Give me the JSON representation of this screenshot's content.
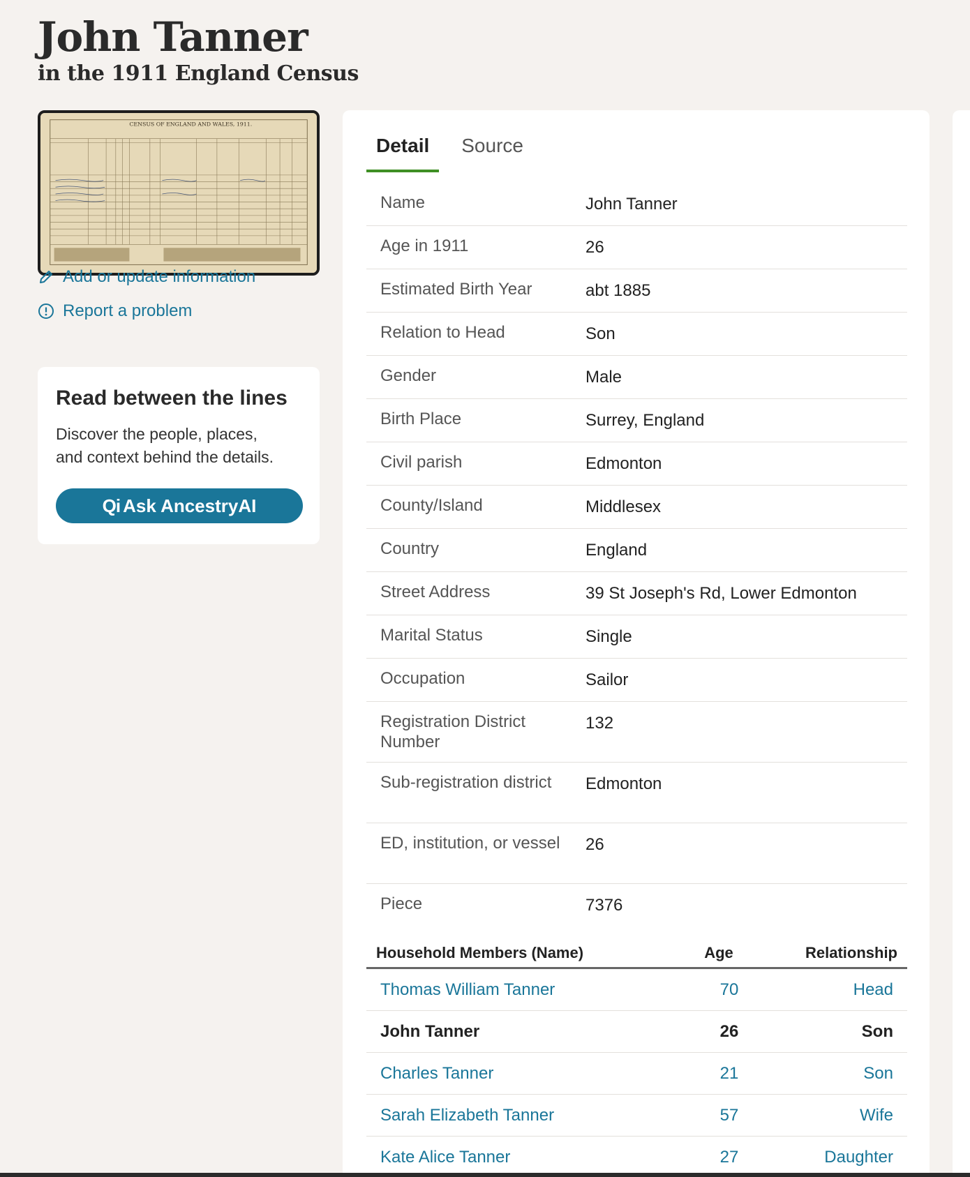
{
  "header": {
    "title": "John Tanner",
    "subtitle": "in the 1911 England Census"
  },
  "thumbnail": {
    "heading": "CENSUS OF ENGLAND AND WALES, 1911."
  },
  "sidebar": {
    "add_update_label": "Add or update information",
    "report_label": "Report a problem",
    "promo": {
      "title": "Read between the lines",
      "text_line1": "Discover the people, places,",
      "text_line2": "and context behind the details.",
      "button_mark": "Qi",
      "button_label": "Ask AncestryAI"
    }
  },
  "tabs": [
    {
      "label": "Detail",
      "active": true
    },
    {
      "label": "Source",
      "active": false
    }
  ],
  "details": [
    {
      "label": "Name",
      "value": "John Tanner"
    },
    {
      "label": "Age in 1911",
      "value": "26"
    },
    {
      "label": "Estimated Birth Year",
      "value": "abt 1885"
    },
    {
      "label": "Relation to Head",
      "value": "Son"
    },
    {
      "label": "Gender",
      "value": "Male"
    },
    {
      "label": "Birth Place",
      "value": "Surrey, England"
    },
    {
      "label": "Civil parish",
      "value": "Edmonton"
    },
    {
      "label": "County/Island",
      "value": "Middlesex"
    },
    {
      "label": "Country",
      "value": "England"
    },
    {
      "label": "Street Address",
      "value": "39 St Joseph's Rd, Lower Edmonton"
    },
    {
      "label": "Marital Status",
      "value": "Single"
    },
    {
      "label": "Occupation",
      "value": "Sailor"
    },
    {
      "label": "Registration District Number",
      "value": "132"
    },
    {
      "label": "Sub-registration district",
      "value": "Edmonton"
    },
    {
      "label": "ED, institution, or vessel",
      "value": "26"
    },
    {
      "label": "Piece",
      "value": "7376"
    }
  ],
  "household": {
    "headers": {
      "name": "Household Members (Name)",
      "age": "Age",
      "relationship": "Relationship"
    },
    "rows": [
      {
        "name": "Thomas William Tanner",
        "age": "70",
        "relationship": "Head"
      },
      {
        "name": "John Tanner",
        "age": "26",
        "relationship": "Son"
      },
      {
        "name": "Charles Tanner",
        "age": "21",
        "relationship": "Son"
      },
      {
        "name": "Sarah Elizabeth Tanner",
        "age": "57",
        "relationship": "Wife"
      },
      {
        "name": "Kate Alice Tanner",
        "age": "27",
        "relationship": "Daughter"
      }
    ]
  },
  "colors": {
    "link": "#1a7699",
    "tab_underline": "#3f8f24",
    "background": "#f5f2ef"
  }
}
